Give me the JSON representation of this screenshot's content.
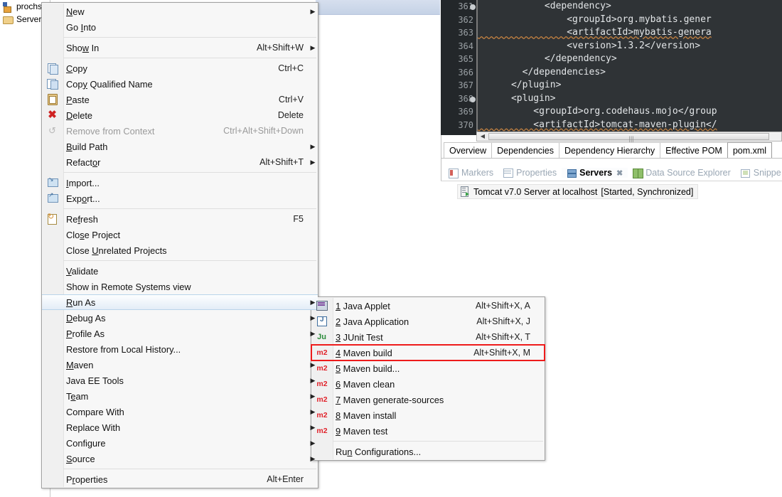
{
  "tree": {
    "items": [
      {
        "label": "prochs",
        "icon": "project-icon",
        "selected": false
      },
      {
        "label": "Servers",
        "icon": "folder-icon",
        "selected": false
      }
    ]
  },
  "editor": {
    "lines": [
      {
        "num": "361",
        "fold": true,
        "text": "            <dependency>"
      },
      {
        "num": "362",
        "fold": false,
        "text": "                <groupId>org.mybatis.gener"
      },
      {
        "num": "363",
        "fold": false,
        "text": "                <artifactId>mybatis-genera",
        "squiggle": true
      },
      {
        "num": "364",
        "fold": false,
        "text": "                <version>1.3.2</version>"
      },
      {
        "num": "365",
        "fold": false,
        "text": "            </dependency>"
      },
      {
        "num": "366",
        "fold": false,
        "text": "        </dependencies>"
      },
      {
        "num": "367",
        "fold": false,
        "text": "      </plugin>"
      },
      {
        "num": "368",
        "fold": true,
        "text": "      <plugin>"
      },
      {
        "num": "369",
        "fold": false,
        "text": "          <groupId>org.codehaus.mojo</group"
      },
      {
        "num": "370",
        "fold": false,
        "text": "          <artifactId>tomcat-maven-plugin</",
        "squiggle": true
      }
    ]
  },
  "page_tabs": [
    {
      "label": "Overview",
      "active": false
    },
    {
      "label": "Dependencies",
      "active": false
    },
    {
      "label": "Dependency Hierarchy",
      "active": false
    },
    {
      "label": "Effective POM",
      "active": false
    },
    {
      "label": "pom.xml",
      "active": true
    }
  ],
  "view_tabs": [
    {
      "label": "Markers",
      "icon": "markers-icon",
      "active": false,
      "closable": false
    },
    {
      "label": "Properties",
      "icon": "properties-icon",
      "active": false,
      "closable": false
    },
    {
      "label": "Servers",
      "icon": "servers-icon",
      "active": true,
      "closable": true
    },
    {
      "label": "Data Source Explorer",
      "icon": "data-source-icon",
      "active": false,
      "closable": false
    },
    {
      "label": "Snippe",
      "icon": "snippets-icon",
      "active": false,
      "closable": false
    }
  ],
  "servers_panel": {
    "server_name": "Tomcat v7.0 Server at localhost",
    "server_status": "[Started, Synchronized]"
  },
  "context_menu": {
    "items": [
      {
        "label": "New",
        "mnemonic": "N",
        "accel": "",
        "arrow": true,
        "icon": "",
        "disabled": false,
        "highlighted": false
      },
      {
        "label": "Go Into",
        "mnemonic": "I",
        "accel": "",
        "arrow": false,
        "icon": "",
        "disabled": false,
        "highlighted": false
      },
      {
        "separator": true
      },
      {
        "label": "Show In",
        "mnemonic": "w",
        "accel": "Alt+Shift+W",
        "arrow": true,
        "icon": "",
        "disabled": false,
        "highlighted": false
      },
      {
        "separator": true
      },
      {
        "label": "Copy",
        "mnemonic": "C",
        "accel": "Ctrl+C",
        "arrow": false,
        "icon": "copy-icon",
        "disabled": false,
        "highlighted": false
      },
      {
        "label": "Copy Qualified Name",
        "mnemonic": "y",
        "accel": "",
        "arrow": false,
        "icon": "copy-qualified-icon",
        "disabled": false,
        "highlighted": false
      },
      {
        "label": "Paste",
        "mnemonic": "P",
        "accel": "Ctrl+V",
        "arrow": false,
        "icon": "paste-icon",
        "disabled": false,
        "highlighted": false
      },
      {
        "label": "Delete",
        "mnemonic": "D",
        "accel": "Delete",
        "arrow": false,
        "icon": "delete-icon",
        "disabled": false,
        "highlighted": false
      },
      {
        "label": "Remove from Context",
        "mnemonic": "",
        "accel": "Ctrl+Alt+Shift+Down",
        "arrow": false,
        "icon": "remove-context-icon",
        "disabled": true,
        "highlighted": false
      },
      {
        "label": "Build Path",
        "mnemonic": "B",
        "accel": "",
        "arrow": true,
        "icon": "",
        "disabled": false,
        "highlighted": false
      },
      {
        "label": "Refactor",
        "mnemonic": "o",
        "accel": "Alt+Shift+T",
        "arrow": true,
        "icon": "",
        "disabled": false,
        "highlighted": false
      },
      {
        "separator": true
      },
      {
        "label": "Import...",
        "mnemonic": "I",
        "accel": "",
        "arrow": false,
        "icon": "import-icon",
        "disabled": false,
        "highlighted": false
      },
      {
        "label": "Export...",
        "mnemonic": "o",
        "accel": "",
        "arrow": false,
        "icon": "export-icon",
        "disabled": false,
        "highlighted": false
      },
      {
        "separator": true
      },
      {
        "label": "Refresh",
        "mnemonic": "f",
        "accel": "F5",
        "arrow": false,
        "icon": "refresh-icon",
        "disabled": false,
        "highlighted": false
      },
      {
        "label": "Close Project",
        "mnemonic": "s",
        "accel": "",
        "arrow": false,
        "icon": "",
        "disabled": false,
        "highlighted": false
      },
      {
        "label": "Close Unrelated Projects",
        "mnemonic": "U",
        "accel": "",
        "arrow": false,
        "icon": "",
        "disabled": false,
        "highlighted": false
      },
      {
        "separator": true
      },
      {
        "label": "Validate",
        "mnemonic": "V",
        "accel": "",
        "arrow": false,
        "icon": "",
        "disabled": false,
        "highlighted": false
      },
      {
        "label": "Show in Remote Systems view",
        "mnemonic": "",
        "accel": "",
        "arrow": false,
        "icon": "",
        "disabled": false,
        "highlighted": false
      },
      {
        "label": "Run As",
        "mnemonic": "R",
        "accel": "",
        "arrow": true,
        "icon": "",
        "disabled": false,
        "highlighted": true
      },
      {
        "label": "Debug As",
        "mnemonic": "D",
        "accel": "",
        "arrow": true,
        "icon": "",
        "disabled": false,
        "highlighted": false
      },
      {
        "label": "Profile As",
        "mnemonic": "P",
        "accel": "",
        "arrow": true,
        "icon": "",
        "disabled": false,
        "highlighted": false
      },
      {
        "label": "Restore from Local History...",
        "mnemonic": "",
        "accel": "",
        "arrow": false,
        "icon": "",
        "disabled": false,
        "highlighted": false
      },
      {
        "label": "Maven",
        "mnemonic": "M",
        "accel": "",
        "arrow": true,
        "icon": "",
        "disabled": false,
        "highlighted": false
      },
      {
        "label": "Java EE Tools",
        "mnemonic": "",
        "accel": "",
        "arrow": true,
        "icon": "",
        "disabled": false,
        "highlighted": false
      },
      {
        "label": "Team",
        "mnemonic": "e",
        "accel": "",
        "arrow": true,
        "icon": "",
        "disabled": false,
        "highlighted": false
      },
      {
        "label": "Compare With",
        "mnemonic": "",
        "accel": "",
        "arrow": true,
        "icon": "",
        "disabled": false,
        "highlighted": false
      },
      {
        "label": "Replace With",
        "mnemonic": "",
        "accel": "",
        "arrow": true,
        "icon": "",
        "disabled": false,
        "highlighted": false
      },
      {
        "label": "Configure",
        "mnemonic": "g",
        "accel": "",
        "arrow": true,
        "icon": "",
        "disabled": false,
        "highlighted": false
      },
      {
        "label": "Source",
        "mnemonic": "S",
        "accel": "",
        "arrow": true,
        "icon": "",
        "disabled": false,
        "highlighted": false
      },
      {
        "separator": true
      },
      {
        "label": "Properties",
        "mnemonic": "r",
        "accel": "Alt+Enter",
        "arrow": false,
        "icon": "",
        "disabled": false,
        "highlighted": false
      }
    ]
  },
  "run_as_submenu": {
    "items": [
      {
        "number": "1",
        "label": "Java Applet",
        "accel": "Alt+Shift+X, A",
        "icon": "java-applet-icon",
        "boxed": false
      },
      {
        "number": "2",
        "label": "Java Application",
        "accel": "Alt+Shift+X, J",
        "icon": "java-application-icon",
        "boxed": false
      },
      {
        "number": "3",
        "label": "JUnit Test",
        "accel": "Alt+Shift+X, T",
        "icon": "junit-icon",
        "boxed": false
      },
      {
        "number": "4",
        "label": "Maven build",
        "accel": "Alt+Shift+X, M",
        "icon": "maven-m2-icon",
        "boxed": true
      },
      {
        "number": "5",
        "label": "Maven build...",
        "accel": "",
        "icon": "maven-m2-icon",
        "boxed": false
      },
      {
        "number": "6",
        "label": "Maven clean",
        "accel": "",
        "icon": "maven-m2-icon",
        "boxed": false
      },
      {
        "number": "7",
        "label": "Maven generate-sources",
        "accel": "",
        "icon": "maven-m2-icon",
        "boxed": false
      },
      {
        "number": "8",
        "label": "Maven install",
        "accel": "",
        "icon": "maven-m2-icon",
        "boxed": false
      },
      {
        "number": "9",
        "label": "Maven test",
        "accel": "",
        "icon": "maven-m2-icon",
        "boxed": false
      },
      {
        "separator": true
      },
      {
        "number": "",
        "label": "Run Configurations...",
        "accel": "",
        "icon": "",
        "boxed": false
      }
    ],
    "m2_label": "m2",
    "junit_label": "Ju"
  },
  "colors": {
    "annotation_red": "#ee1b1b",
    "maven_red": "#e0222a",
    "highlight_blue": "#b9d4ea",
    "editor_bg": "#2f3336"
  }
}
